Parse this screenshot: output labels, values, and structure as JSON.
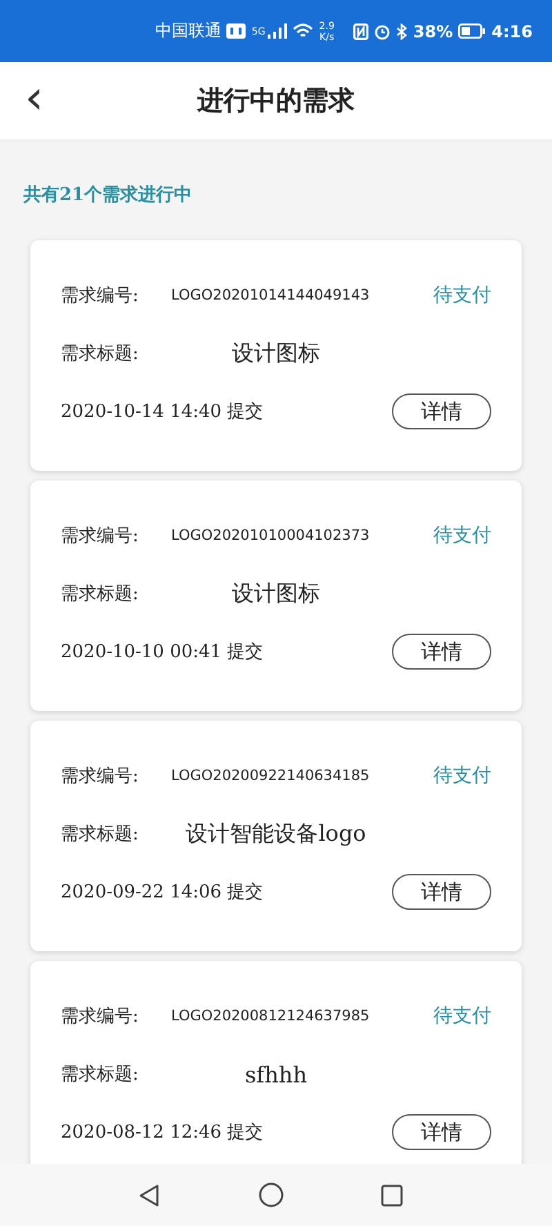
{
  "status_bar": {
    "carrier": "中国联通",
    "network": "5G",
    "speed_value": "2.9",
    "speed_unit": "K/s",
    "battery": "38%",
    "time": "4:16"
  },
  "header": {
    "back": "‹",
    "title": "进行中的需求"
  },
  "summary": "共有21个需求进行中",
  "orders": [
    {
      "id_label": "需求编号:",
      "id": "LOGO20201014144049143",
      "status": "待支付",
      "title_label": "需求标题:",
      "title": "设计图标",
      "submitted": "2020-10-14 14:40 提交",
      "action": "详情"
    },
    {
      "id_label": "需求编号:",
      "id": "LOGO20201010004102373",
      "status": "待支付",
      "title_label": "需求标题:",
      "title": "设计图标",
      "submitted": "2020-10-10 00:41 提交",
      "action": "详情"
    },
    {
      "id_label": "需求编号:",
      "id": "LOGO20200922140634185",
      "status": "待支付",
      "title_label": "需求标题:",
      "title": "设计智能设备logo",
      "submitted": "2020-09-22 14:06 提交",
      "action": "详情"
    },
    {
      "id_label": "需求编号:",
      "id": "LOGO20200812124637985",
      "status": "待支付",
      "title_label": "需求标题:",
      "title": "sfhhh",
      "submitted": "2020-08-12 12:46 提交",
      "action": "详情"
    }
  ]
}
